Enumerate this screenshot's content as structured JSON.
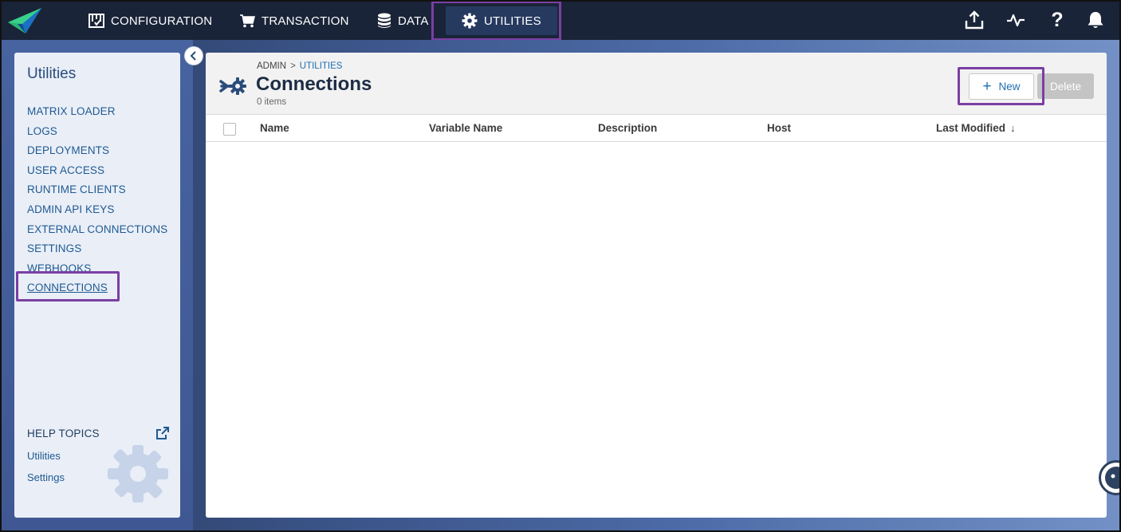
{
  "topnav": {
    "items": [
      {
        "label": "CONFIGURATION",
        "icon": "configuration-icon"
      },
      {
        "label": "TRANSACTION",
        "icon": "cart-icon"
      },
      {
        "label": "DATA",
        "icon": "database-icon"
      },
      {
        "label": "UTILITIES",
        "icon": "gear-icon",
        "active": true
      }
    ],
    "right_icons": [
      "upload-icon",
      "activity-icon",
      "help-icon",
      "bell-icon"
    ],
    "help_glyph": "?"
  },
  "sidebar": {
    "title": "Utilities",
    "items": [
      {
        "label": "MATRIX LOADER"
      },
      {
        "label": "LOGS"
      },
      {
        "label": "DEPLOYMENTS"
      },
      {
        "label": "USER ACCESS"
      },
      {
        "label": "RUNTIME CLIENTS"
      },
      {
        "label": "ADMIN API KEYS"
      },
      {
        "label": "EXTERNAL CONNECTIONS"
      },
      {
        "label": "SETTINGS"
      },
      {
        "label": "WEBHOOKS"
      },
      {
        "label": "CONNECTIONS",
        "current": true
      }
    ],
    "help": {
      "title": "HELP TOPICS",
      "links": [
        "Utilities",
        "Settings"
      ]
    }
  },
  "main": {
    "breadcrumb": {
      "root": "ADMIN",
      "separator": ">",
      "current": "UTILITIES"
    },
    "title": "Connections",
    "item_count": "0 items",
    "buttons": {
      "new": "New",
      "new_glyph": "+",
      "delete": "Delete"
    },
    "columns": [
      "Name",
      "Variable Name",
      "Description",
      "Host",
      "Last Modified"
    ],
    "sort_glyph": "↓",
    "rows": []
  },
  "colors": {
    "topbar": "#1a2438",
    "highlight": "#7b3fa3",
    "link": "#1f5a92",
    "active_nav": "#26395e"
  }
}
